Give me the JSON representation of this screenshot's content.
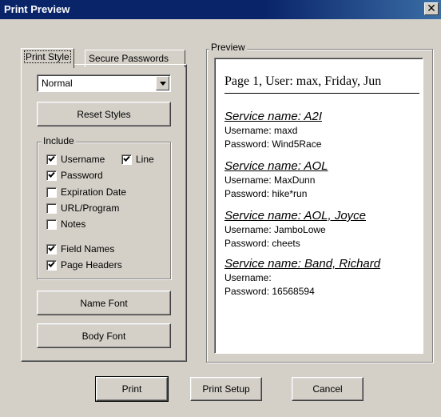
{
  "window": {
    "title": "Print Preview",
    "close_glyph": "✕"
  },
  "tabs": [
    {
      "label": "Print Style"
    },
    {
      "label": "Secure Passwords"
    }
  ],
  "print_style": {
    "style_select": {
      "value": "Normal",
      "arrow_icon": "dropdown-arrow-icon"
    },
    "reset_styles_label": "Reset Styles",
    "include": {
      "label": "Include",
      "options": [
        {
          "label": "Username",
          "checked": true
        },
        {
          "label": "Line",
          "checked": true
        },
        {
          "label": "Password",
          "checked": true
        },
        {
          "label": "Expiration Date",
          "checked": false
        },
        {
          "label": "URL/Program",
          "checked": false
        },
        {
          "label": "Notes",
          "checked": false
        },
        {
          "label": "Field Names",
          "checked": true
        },
        {
          "label": "Page Headers",
          "checked": true
        }
      ]
    },
    "name_font_label": "Name Font",
    "body_font_label": "Body Font"
  },
  "preview": {
    "label": "Preview",
    "header": "Page 1, User: max, Friday, Jun",
    "entries": [
      {
        "service": "Service name: A2I",
        "username": "Username: maxd",
        "password": "Password: Wind5Race"
      },
      {
        "service": "Service name: AOL",
        "username": "Username: MaxDunn",
        "password": "Password: hike*run"
      },
      {
        "service": "Service name: AOL, Joyce",
        "username": "Username: JamboLowe",
        "password": "Password: cheets"
      },
      {
        "service": "Service name: Band, Richard",
        "username": "Username:",
        "password": "Password: 16568594"
      }
    ]
  },
  "footer": {
    "print_label": "Print",
    "print_setup_label": "Print Setup",
    "cancel_label": "Cancel"
  }
}
